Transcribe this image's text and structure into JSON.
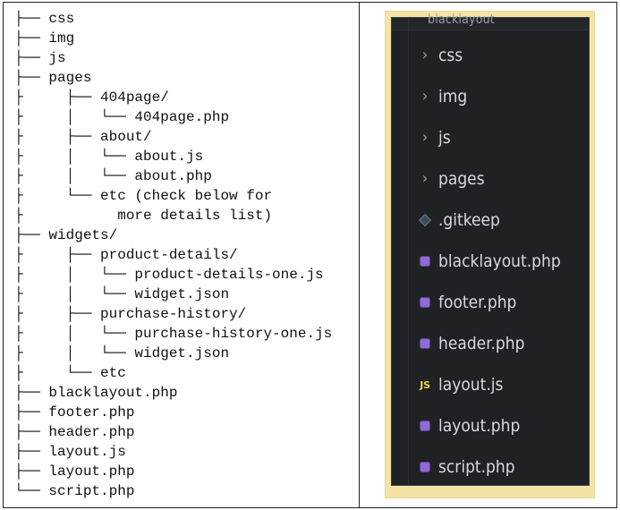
{
  "left_tree": {
    "lines": [
      "├── css",
      "├── img",
      "├── js",
      "├── pages",
      "├     ├── 404page/",
      "├     │   └── 404page.php",
      "├     ├── about/",
      "├     │   └── about.js",
      "├     │   └── about.php",
      "├     └── etc (check below for",
      "├           more details list)",
      "├── widgets/",
      "├     ├── product-details/",
      "├     │   └── product-details-one.js",
      "├     │   └── widget.json",
      "├     ├── purchase-history/",
      "├     │   └── purchase-history-one.js",
      "├     │   └── widget.json",
      "├     └── etc",
      "├── blacklayout.php",
      "├── footer.php",
      "├── header.php",
      "├── layout.js",
      "├── layout.php",
      "└── script.php"
    ]
  },
  "explorer": {
    "top_clipped_label": "blacklayout",
    "items": [
      {
        "icon": "chevron-right-icon",
        "label": "css"
      },
      {
        "icon": "chevron-right-icon",
        "label": "img"
      },
      {
        "icon": "chevron-right-icon",
        "label": "js"
      },
      {
        "icon": "chevron-right-icon",
        "label": "pages"
      },
      {
        "icon": "gitkeep-icon",
        "label": ".gitkeep"
      },
      {
        "icon": "php-file-icon",
        "label": "blacklayout.php"
      },
      {
        "icon": "php-file-icon",
        "label": "footer.php"
      },
      {
        "icon": "php-file-icon",
        "label": "header.php"
      },
      {
        "icon": "js-file-icon",
        "label": "layout.js"
      },
      {
        "icon": "php-file-icon",
        "label": "layout.php"
      },
      {
        "icon": "php-file-icon",
        "label": "script.php"
      }
    ]
  },
  "colors": {
    "page_bg": "#ffffff",
    "explorer_bg": "#1f2124",
    "panel_border": "#f3e4a6",
    "php_icon": "#8e6bd6",
    "js_icon": "#f2d14a"
  }
}
